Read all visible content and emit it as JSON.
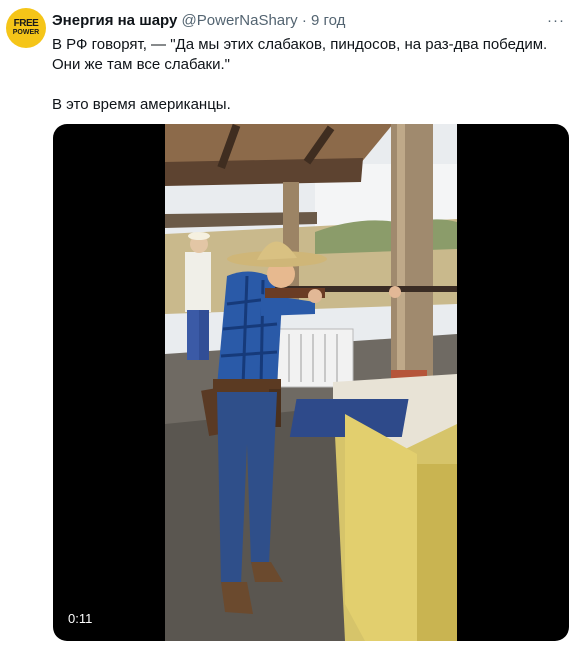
{
  "tweet": {
    "avatar_text_top": "FREE",
    "avatar_text_bottom": "POWER",
    "display_name": "Энергия на шару",
    "handle": "@PowerNaShary",
    "separator": "·",
    "time": "9 год",
    "more_icon": "ellipsis-icon",
    "text_line1": "В РФ говорят, — \"Да мы этих слабаков, пиндосов, на раз-два победим.",
    "text_line2": "Они же там все слабаки.\"",
    "text_line3": "В это время американцы.",
    "video": {
      "duration": "0:11"
    }
  },
  "colors": {
    "avatar_bg": "#f5c518",
    "secondary_text": "#536471",
    "primary_text": "#0f1419"
  }
}
